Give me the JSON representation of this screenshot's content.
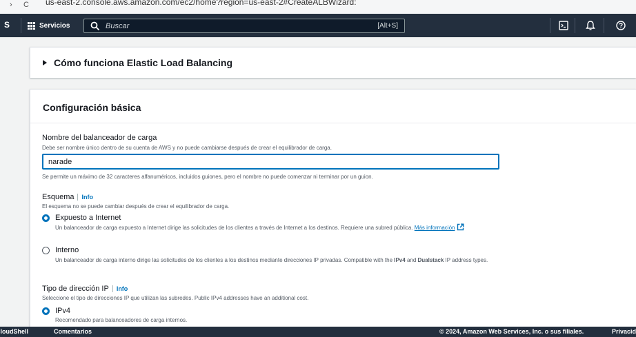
{
  "browser": {
    "nav_back": "›",
    "nav_reload": "C",
    "url": "us-east-2.console.aws.amazon.com/ec2/home?region=us-east-2#CreateALBWizard:"
  },
  "topnav": {
    "logo_fragment": "S",
    "services_label": "Servicios",
    "search_placeholder": "Buscar",
    "search_shortcut": "[Alt+S]",
    "icons": [
      "cloudshell-icon",
      "bell-icon",
      "help-icon"
    ]
  },
  "how_it_works": {
    "title": "Cómo funciona Elastic Load Balancing"
  },
  "basic_config": {
    "title": "Configuración básica",
    "lb_name": {
      "label": "Nombre del balanceador de carga",
      "description": "Debe ser nombre único dentro de su cuenta de AWS y no puede cambiarse después de crear el equilibrador de carga.",
      "value": "narade",
      "hint": "Se permite un máximo de 32 caracteres alfanuméricos, incluidos guiones, pero el nombre no puede comenzar ni terminar por un guion."
    },
    "scheme": {
      "label": "Esquema",
      "info": "Info",
      "description": "El esquema no se puede cambiar después de crear el equilibrador de carga.",
      "options": [
        {
          "label": "Expuesto a Internet",
          "checked": true,
          "description": "Un balanceador de carga expuesto a Internet dirige las solicitudes de los clientes a través de Internet a los destinos. Requiere una subred pública.",
          "link": "Más información"
        },
        {
          "label": "Interno",
          "checked": false,
          "description_pre": "Un balanceador de carga interno dirige las solicitudes de los clientes a los destinos mediante direcciones IP privadas. Compatible with the ",
          "bold1": "IPv4",
          "mid": " and ",
          "bold2": "Dualstack",
          "post": " IP address types."
        }
      ]
    },
    "ip_type": {
      "label": "Tipo de dirección IP",
      "info": "Info",
      "description": "Seleccione el tipo de direcciones IP que utilizan las subredes. Public IPv4 addresses have an additional cost.",
      "options": [
        {
          "label": "IPv4",
          "checked": true,
          "description": "Recomendado para balanceadores de carga internos."
        }
      ]
    }
  },
  "footer": {
    "cloudshell": "CloudShell",
    "feedback": "Comentarios",
    "copyright": "© 2024, Amazon Web Services, Inc. o sus filiales.",
    "privacy": "Privacidad"
  },
  "colors": {
    "nav_bg": "#232f3e",
    "accent_blue": "#0073bb",
    "page_bg": "#f2f3f3"
  }
}
